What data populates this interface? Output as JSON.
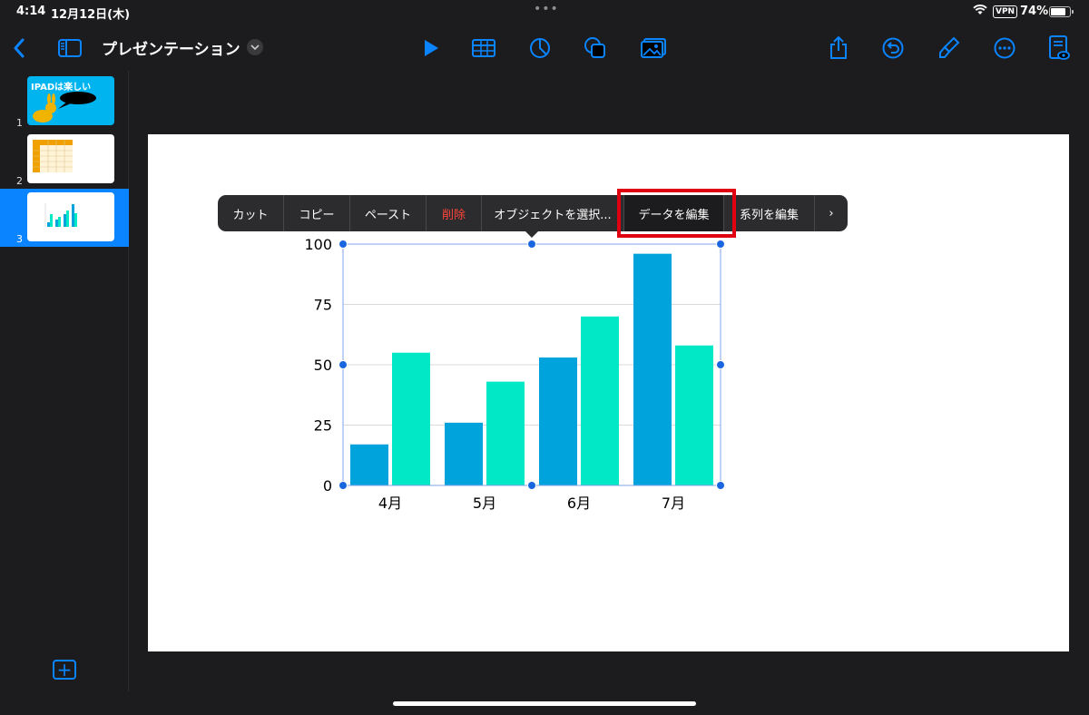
{
  "status_bar": {
    "time": "4:14",
    "date": "12月12日(木)",
    "vpn": "VPN",
    "battery_percent": "74%",
    "battery_level": 0.74
  },
  "toolbar": {
    "title": "プレゼンテーション",
    "icons": [
      "back-icon",
      "sidebar-icon",
      "chevron-down-icon",
      "play-icon",
      "table-icon",
      "chart-icon",
      "shape-icon",
      "media-icon",
      "share-icon",
      "undo-icon",
      "format-brush-icon",
      "more-icon",
      "presenter-view-icon"
    ]
  },
  "sidebar": {
    "slides": [
      {
        "number": "1",
        "title": "IPADは楽しい"
      },
      {
        "number": "2"
      },
      {
        "number": "3",
        "selected": true
      }
    ]
  },
  "context_menu": {
    "items": [
      {
        "label": "カット"
      },
      {
        "label": "コピー"
      },
      {
        "label": "ペースト"
      },
      {
        "label": "削除",
        "danger": true
      },
      {
        "label": "オブジェクトを選択..."
      },
      {
        "label": "データを編集",
        "highlighted": true
      },
      {
        "label": "系列を編集"
      },
      {
        "label": "›"
      }
    ]
  },
  "chart_data": {
    "type": "bar",
    "categories": [
      "4月",
      "5月",
      "6月",
      "7月"
    ],
    "series": [
      {
        "values": [
          17,
          26,
          53,
          96
        ],
        "color": "#00a3dc"
      },
      {
        "values": [
          55,
          43,
          70,
          58
        ],
        "color": "#00e8c6"
      }
    ],
    "ylim": [
      0,
      100
    ],
    "yticks": [
      "0",
      "25",
      "50",
      "75",
      "100"
    ],
    "grid": true
  },
  "colors": {
    "accent": "#0a84ff",
    "highlight_box": "#e00012"
  }
}
